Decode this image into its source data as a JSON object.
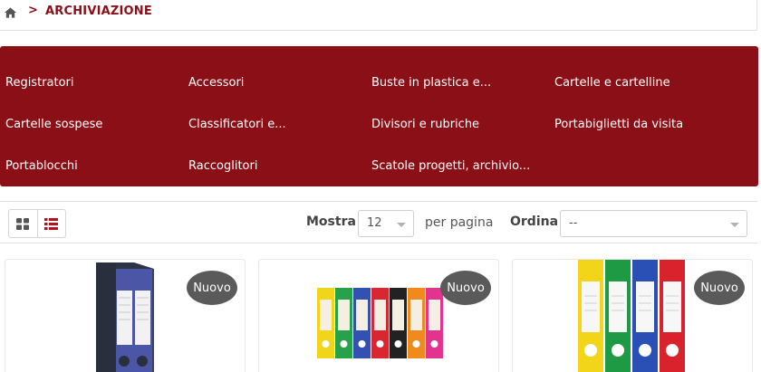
{
  "breadcrumb": {
    "separator": ">",
    "current": "ARCHIVIAZIONE"
  },
  "categories": [
    "Registratori",
    "Accessori",
    "Buste in plastica e...",
    "Cartelle e cartelline",
    "Cartelle sospese",
    "Classificatori e...",
    "Divisori e rubriche",
    "Portabiglietti da visita",
    "Portablocchi",
    "Raccoglitori",
    "Scatole progetti, archivio..."
  ],
  "toolbar": {
    "show_label": "Mostra",
    "per_page_value": "12",
    "per_page_label": "per pagina",
    "order_label": "Ordina",
    "order_value": "--"
  },
  "products": [
    {
      "badge": "Nuovo"
    },
    {
      "badge": "Nuovo"
    },
    {
      "badge": "Nuovo"
    }
  ],
  "colors": {
    "brand": "#8b0f17",
    "badge": "#5a5a5a"
  },
  "icons": {
    "home": "home-icon",
    "grid": "grid-view-icon",
    "list": "list-view-icon",
    "dropdown": "chevron-down-icon"
  }
}
